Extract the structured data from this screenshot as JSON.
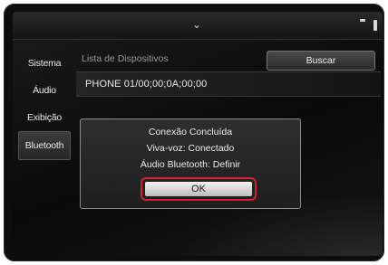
{
  "topbar": {
    "chevron_icon": "chevron-down-icon",
    "status_icons": [
      "signal-icon",
      "battery-icon"
    ]
  },
  "sidebar": {
    "items": [
      {
        "label": "Sistema",
        "active": false
      },
      {
        "label": "Áudio",
        "active": false
      },
      {
        "label": "Exibição",
        "active": false
      },
      {
        "label": "Bluetooth",
        "active": true
      }
    ]
  },
  "main": {
    "list_title": "Lista de Dispositivos",
    "search_label": "Buscar",
    "device": "PHONE 01/00;00;0A;00;00"
  },
  "dialog": {
    "line1": "Conexão Concluída",
    "line2": "Viva-voz: Conectado",
    "line3": "Áudio Bluetooth: Definir",
    "ok_label": "OK"
  },
  "colors": {
    "highlight": "#d2202e"
  }
}
